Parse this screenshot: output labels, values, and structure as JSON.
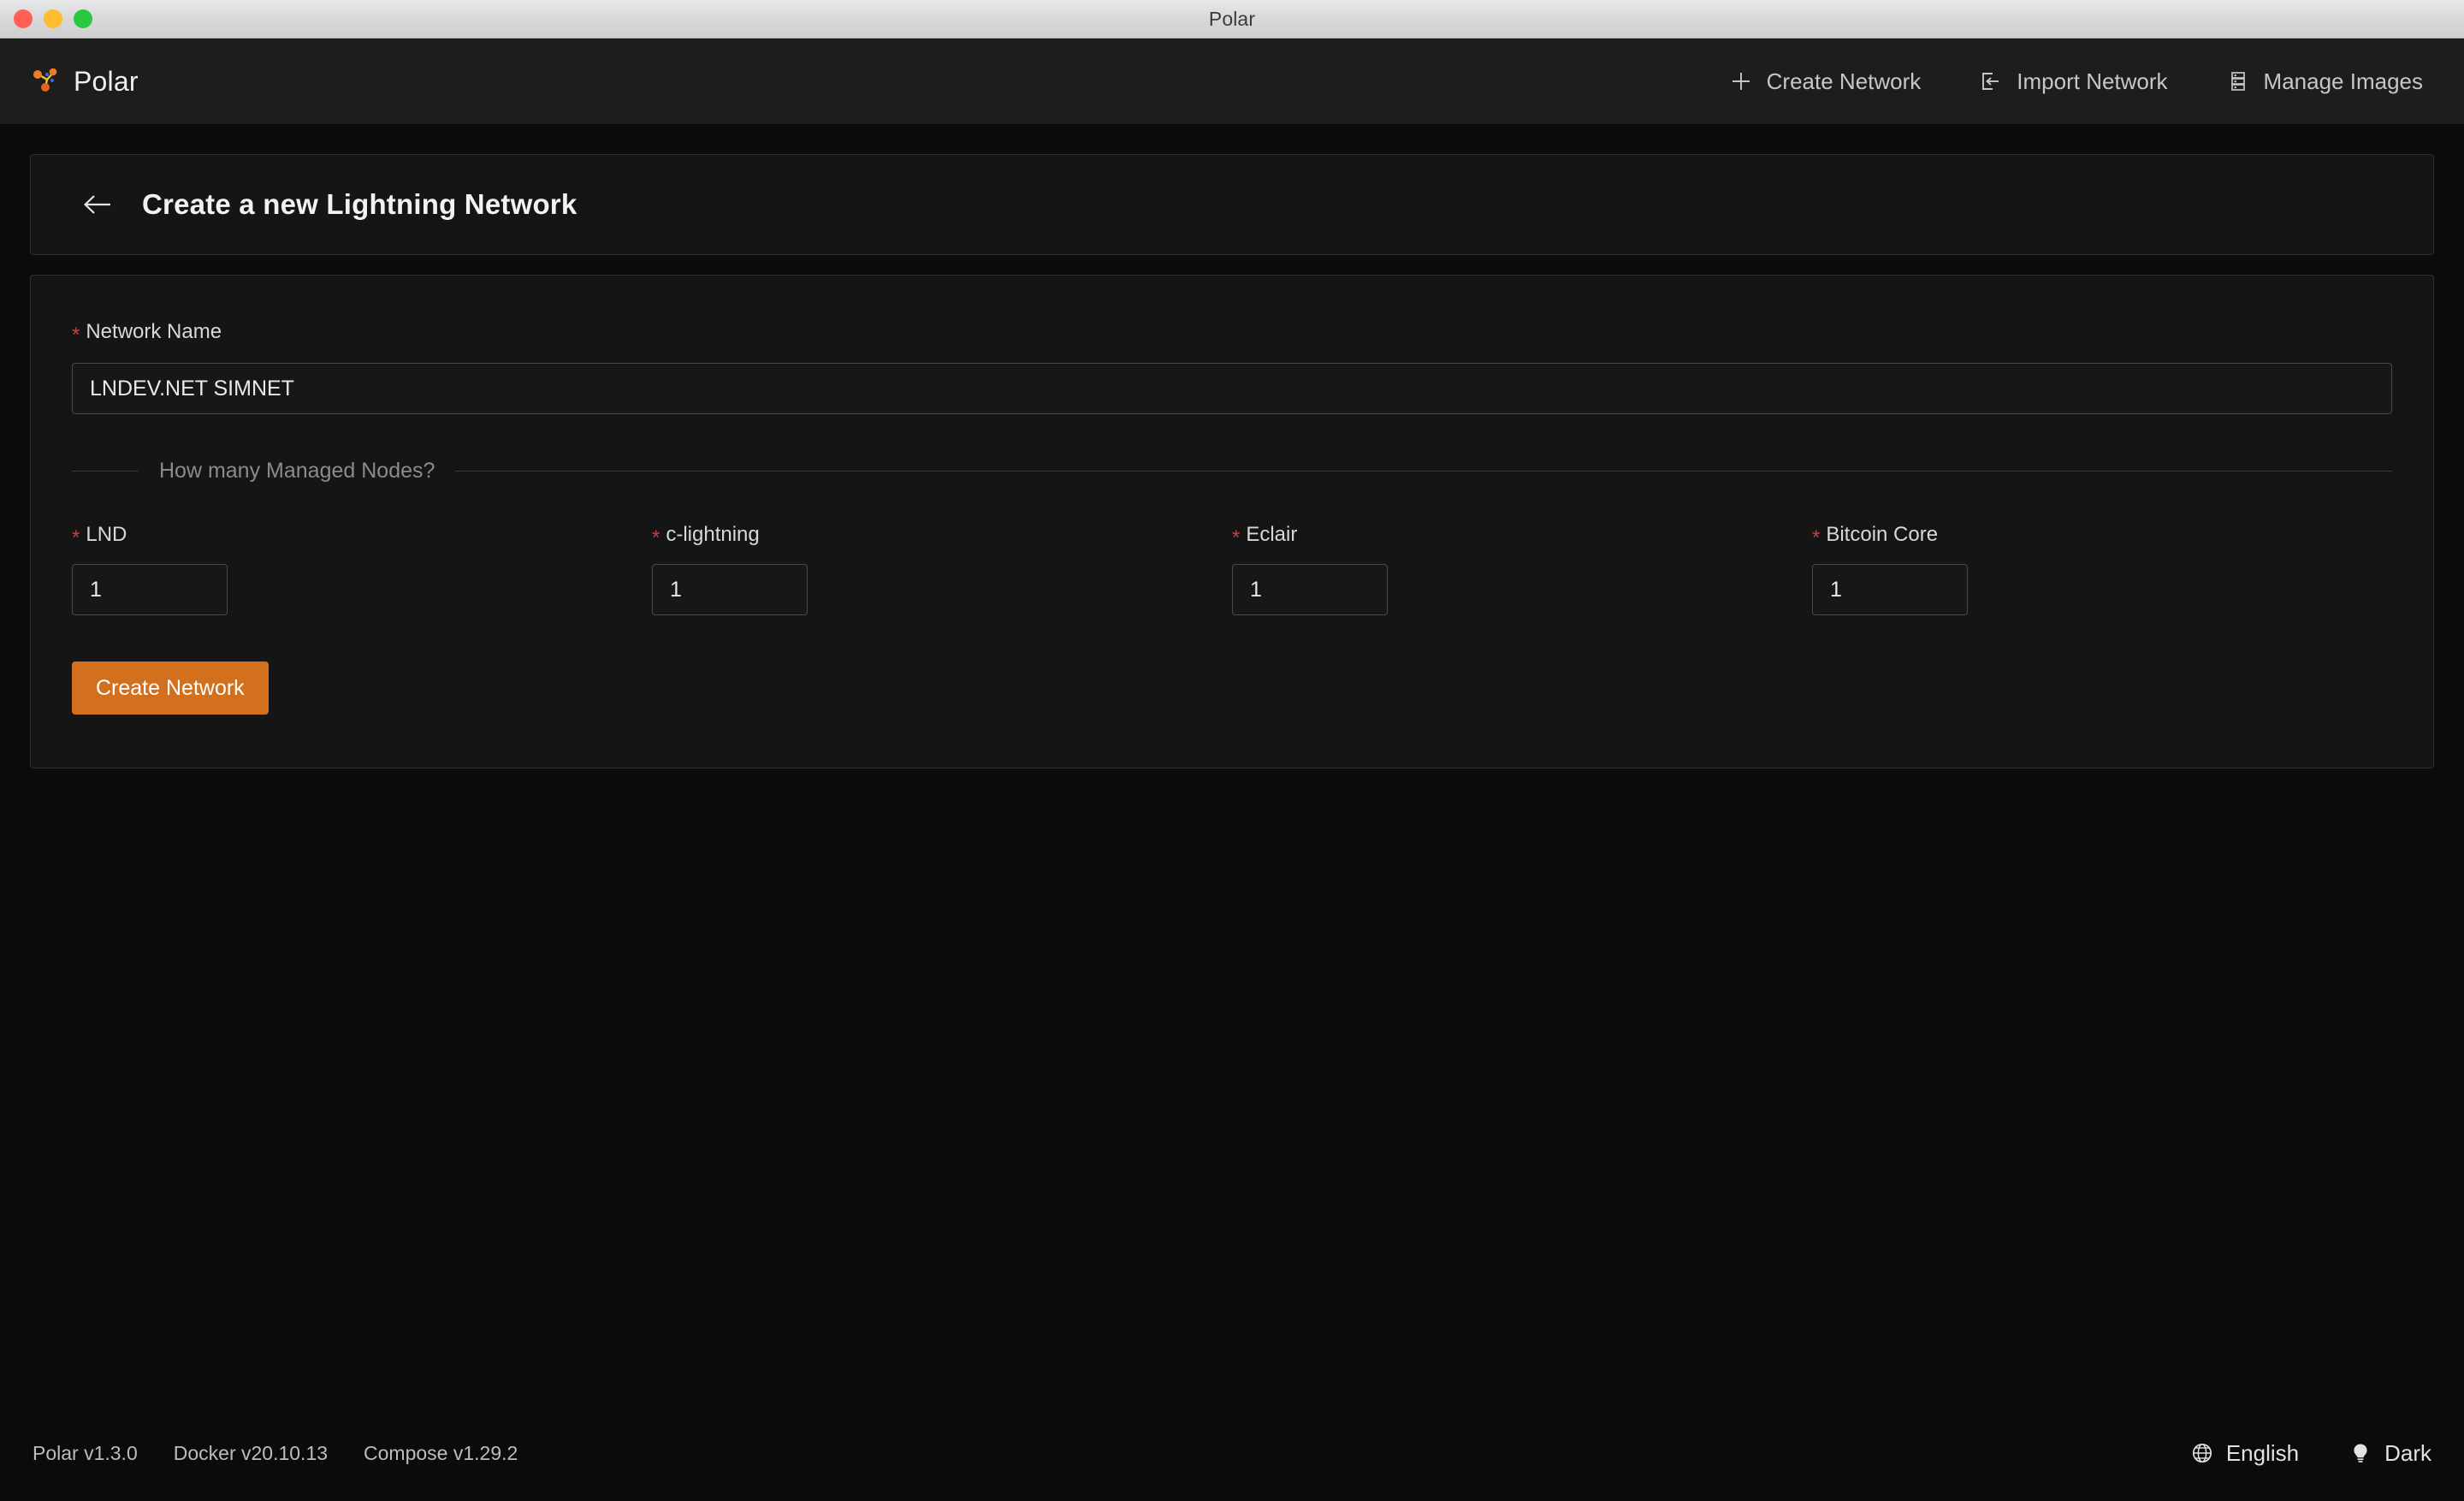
{
  "window": {
    "title": "Polar",
    "controls": [
      "close",
      "minimize",
      "maximize"
    ]
  },
  "header": {
    "brand": "Polar",
    "brand_icon": "polar-network-logo",
    "nav": [
      {
        "label": "Create Network",
        "icon": "plus-icon"
      },
      {
        "label": "Import Network",
        "icon": "import-icon"
      },
      {
        "label": "Manage Images",
        "icon": "database-stack-icon"
      }
    ]
  },
  "page": {
    "back_icon": "arrow-left-icon",
    "title": "Create a new Lightning Network"
  },
  "form": {
    "network_name": {
      "label": "Network Name",
      "required_mark": "*",
      "value": "LNDEV.NET SIMNET",
      "placeholder": ""
    },
    "divider_text": "How many Managed Nodes?",
    "nodes": [
      {
        "label": "LND",
        "required_mark": "*",
        "value": "1"
      },
      {
        "label": "c-lightning",
        "required_mark": "*",
        "value": "1"
      },
      {
        "label": "Eclair",
        "required_mark": "*",
        "value": "1"
      },
      {
        "label": "Bitcoin Core",
        "required_mark": "*",
        "value": "1"
      }
    ],
    "submit_label": "Create Network"
  },
  "footer": {
    "versions": [
      "Polar v1.3.0",
      "Docker v20.10.13",
      "Compose v1.29.2"
    ],
    "language": {
      "label": "English",
      "icon": "globe-icon"
    },
    "theme": {
      "label": "Dark",
      "icon": "lightbulb-icon"
    }
  },
  "colors": {
    "accent": "#d2701e",
    "required": "#c14242",
    "page_bg": "#0b0b0b",
    "card_bg": "#151515",
    "header_bg": "#1d1d1d",
    "border": "#303030",
    "logo_orange": "#ef7b28",
    "logo_yellow": "#f5c518",
    "logo_blue": "#2f6fe0"
  }
}
